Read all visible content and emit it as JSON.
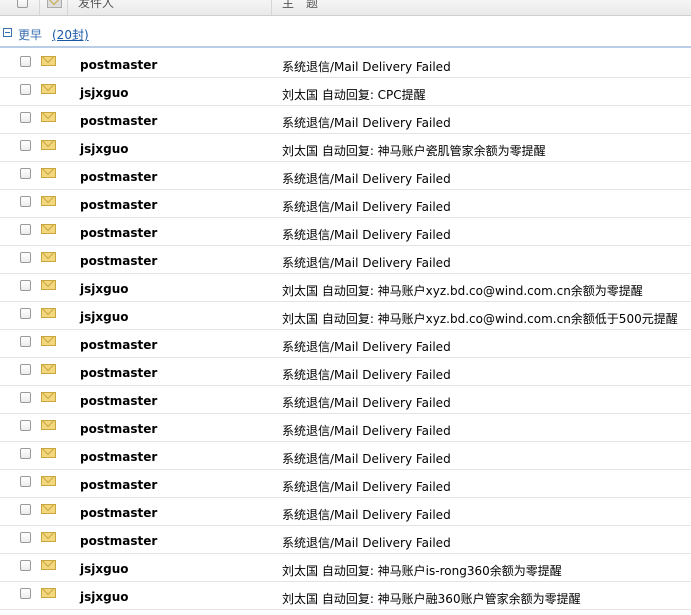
{
  "header": {
    "sender_label": "发件人",
    "subject_label": "主　题"
  },
  "group": {
    "label": "更早",
    "count": "(20封)"
  },
  "rows": [
    {
      "sender": "postmaster",
      "subject": "系统退信/Mail Delivery Failed"
    },
    {
      "sender": "jsjxguo",
      "subject": "刘太国 自动回复: CPC提醒"
    },
    {
      "sender": "postmaster",
      "subject": "系统退信/Mail Delivery Failed"
    },
    {
      "sender": "jsjxguo",
      "subject": "刘太国 自动回复: 神马账户瓷肌管家余额为零提醒"
    },
    {
      "sender": "postmaster",
      "subject": "系统退信/Mail Delivery Failed"
    },
    {
      "sender": "postmaster",
      "subject": "系统退信/Mail Delivery Failed"
    },
    {
      "sender": "postmaster",
      "subject": "系统退信/Mail Delivery Failed"
    },
    {
      "sender": "postmaster",
      "subject": "系统退信/Mail Delivery Failed"
    },
    {
      "sender": "jsjxguo",
      "subject": "刘太国 自动回复: 神马账户xyz.bd.co@wind.com.cn余额为零提醒"
    },
    {
      "sender": "jsjxguo",
      "subject": "刘太国 自动回复: 神马账户xyz.bd.co@wind.com.cn余额低于500元提醒"
    },
    {
      "sender": "postmaster",
      "subject": "系统退信/Mail Delivery Failed"
    },
    {
      "sender": "postmaster",
      "subject": "系统退信/Mail Delivery Failed"
    },
    {
      "sender": "postmaster",
      "subject": "系统退信/Mail Delivery Failed"
    },
    {
      "sender": "postmaster",
      "subject": "系统退信/Mail Delivery Failed"
    },
    {
      "sender": "postmaster",
      "subject": "系统退信/Mail Delivery Failed"
    },
    {
      "sender": "postmaster",
      "subject": "系统退信/Mail Delivery Failed"
    },
    {
      "sender": "postmaster",
      "subject": "系统退信/Mail Delivery Failed"
    },
    {
      "sender": "postmaster",
      "subject": "系统退信/Mail Delivery Failed"
    },
    {
      "sender": "jsjxguo",
      "subject": "刘太国 自动回复: 神马账户is-rong360余额为零提醒"
    },
    {
      "sender": "jsjxguo",
      "subject": "刘太国 自动回复: 神马账户融360账户管家余额为零提醒"
    }
  ],
  "icons": {
    "checkbox": "checkbox-icon",
    "envelope": "envelope-icon",
    "collapse": "collapse-toggle-icon"
  },
  "colors": {
    "group_text": "#3a6fb0",
    "link": "#1b57a8",
    "envelope": "#f2d77e"
  }
}
